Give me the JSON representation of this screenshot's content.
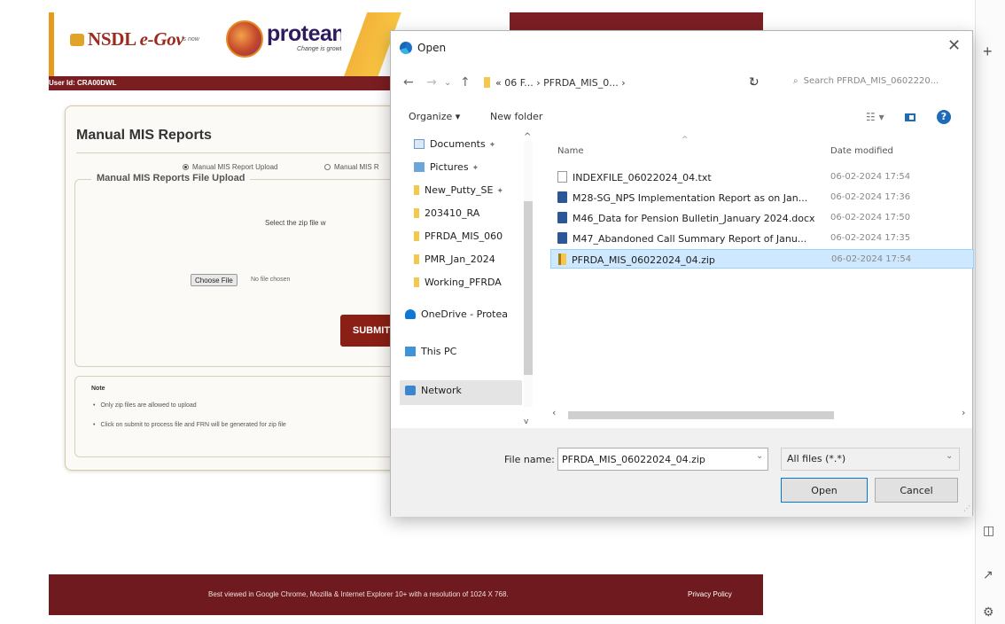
{
  "webpage": {
    "header": {
      "nsdl_brand": "NSDL",
      "nsdl_egov": "e-Gov",
      "nsdl_tag": "is now",
      "protean_name": "protean",
      "protean_tagline": "Change is growth"
    },
    "user_id": "User Id: CRA00DWL",
    "panel": {
      "title": "Manual MIS Reports",
      "radio_upload_label": "Manual MIS Report Upload",
      "radio_other_label": "Manual MIS R",
      "fieldset_legend": "Manual MIS Reports File Upload",
      "select_zip_label": "Select the zip file w",
      "choose_file_label": "Choose File",
      "no_file_label": "No file chosen",
      "submit_label": "SUBMIT"
    },
    "note": {
      "heading": "Note",
      "items": [
        "Only zip files are allowed to upload",
        "Click on submit to process file and FRN will be generated for zip file"
      ]
    },
    "footer": {
      "text": "Best viewed in Google Chrome, Mozilla & Internet Explorer 10+ with a resolution of 1024 X 768.",
      "privacy_label": "Privacy Policy"
    }
  },
  "browser_sidebar": {
    "new_tab_glyph": "+",
    "split_glyph": "◫",
    "popout_glyph": "↗",
    "settings_glyph": "⚙"
  },
  "dialog": {
    "title": "Open",
    "close_glyph": "✕",
    "nav": {
      "back": "←",
      "forward": "→",
      "history": "⌄",
      "up": "↑",
      "address": "« 06 F... › PFRDA_MIS_0... ›",
      "address_chevron": "⌄",
      "refresh": "↻",
      "search_placeholder": "Search PFRDA_MIS_0602220..."
    },
    "toolbar": {
      "organize": "Organize ▾",
      "new_folder": "New folder",
      "view": "☷ ▾",
      "help": "?"
    },
    "nav_pane": [
      {
        "label": "Documents",
        "icon": "documents-icon",
        "pinned": true
      },
      {
        "label": "Pictures",
        "icon": "pictures-icon",
        "pinned": true
      },
      {
        "label": "New_Putty_SE",
        "icon": "folder-icon",
        "pinned": true
      },
      {
        "label": "203410_RA",
        "icon": "folder-icon",
        "pinned": false
      },
      {
        "label": "PFRDA_MIS_060",
        "icon": "folder-icon",
        "pinned": false
      },
      {
        "label": "PMR_Jan_2024",
        "icon": "folder-icon",
        "pinned": false
      },
      {
        "label": "Working_PFRDA",
        "icon": "folder-icon",
        "pinned": false
      },
      {
        "label": "OneDrive - Protea",
        "icon": "onedrive-icon",
        "pinned": false
      },
      {
        "label": "This PC",
        "icon": "this-pc-icon",
        "pinned": false
      },
      {
        "label": "Network",
        "icon": "network-icon",
        "pinned": false
      }
    ],
    "columns": {
      "name": "Name",
      "date": "Date modified"
    },
    "files": [
      {
        "name": "INDEXFILE_06022024_04.txt",
        "date": "06-02-2024 17:54",
        "icon": "text-file-icon",
        "selected": false
      },
      {
        "name": "M28-SG_NPS Implementation Report as on Jan...",
        "date": "06-02-2024 17:36",
        "icon": "word-file-icon",
        "selected": false
      },
      {
        "name": "M46_Data for Pension Bulletin_January 2024.docx",
        "date": "06-02-2024 17:50",
        "icon": "word-file-icon",
        "selected": false
      },
      {
        "name": "M47_Abandoned Call Summary Report of Janu...",
        "date": "06-02-2024 17:35",
        "icon": "word-file-icon",
        "selected": false
      },
      {
        "name": "PFRDA_MIS_06022024_04.zip",
        "date": "06-02-2024 17:54",
        "icon": "zip-file-icon",
        "selected": true
      }
    ],
    "bottom": {
      "filename_label": "File name:",
      "filename_value": "PFRDA_MIS_06022024_04.zip",
      "filetype_value": "All files (*.*)",
      "open_label": "Open",
      "cancel_label": "Cancel"
    }
  }
}
